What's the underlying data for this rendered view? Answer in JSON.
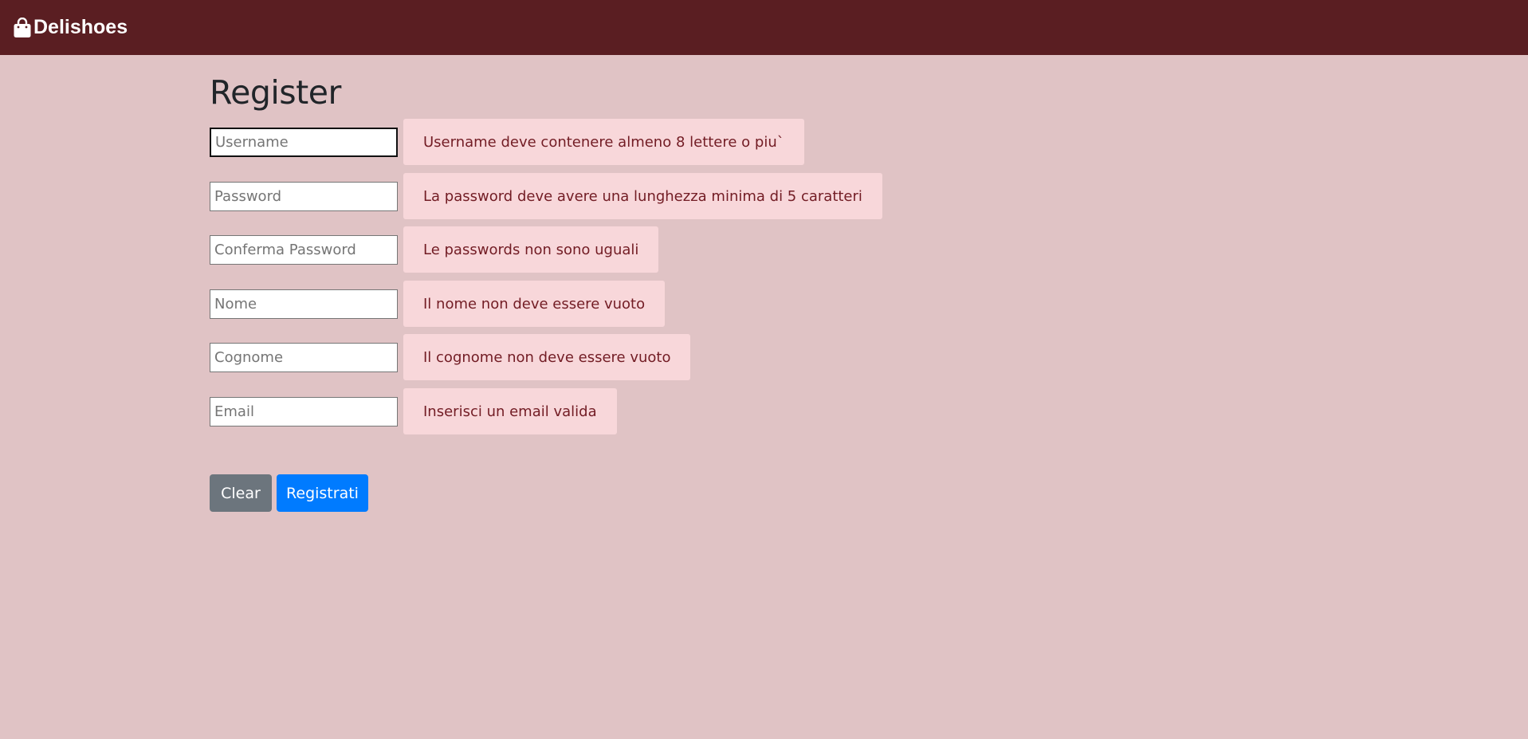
{
  "navbar": {
    "brand": "Delishoes",
    "brand_icon": "shopping-bag-icon",
    "bg_color": "#5a1e22"
  },
  "page": {
    "title": "Register",
    "bg_color": "#e0c3c5"
  },
  "form": {
    "fields": [
      {
        "placeholder": "Username",
        "value": "",
        "error": "Username deve contenere almeno 8 lettere o piu`"
      },
      {
        "placeholder": "Password",
        "value": "",
        "error": "La password deve avere una lunghezza minima di 5 caratteri"
      },
      {
        "placeholder": "Conferma Password",
        "value": "",
        "error": "Le passwords non sono uguali"
      },
      {
        "placeholder": "Nome",
        "value": "",
        "error": "Il nome non deve essere vuoto"
      },
      {
        "placeholder": "Cognome",
        "value": "",
        "error": "Il cognome non deve essere vuoto"
      },
      {
        "placeholder": "Email",
        "value": "",
        "error": "Inserisci un email valida"
      }
    ],
    "clear_label": "Clear",
    "submit_label": "Registrati"
  },
  "colors": {
    "alert_bg": "#f8d7da",
    "alert_text": "#721c24",
    "clear_button": "#6c757d",
    "submit_button": "#007bff"
  }
}
